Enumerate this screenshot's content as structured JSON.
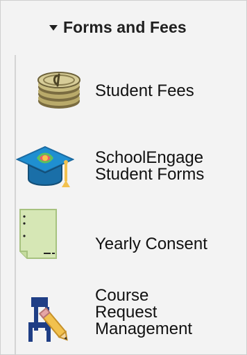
{
  "section": {
    "title": "Forms and Fees"
  },
  "items": [
    {
      "icon": "coin-stack-icon",
      "label_lines": [
        "Student Fees"
      ]
    },
    {
      "icon": "graduation-cap-icon",
      "label_lines": [
        "SchoolEngage",
        "Student Forms"
      ]
    },
    {
      "icon": "document-icon",
      "label_lines": [
        "Yearly Consent"
      ]
    },
    {
      "icon": "desk-chair-pencil-icon",
      "label_lines": [
        "Course",
        "Request",
        "Management"
      ]
    }
  ]
}
